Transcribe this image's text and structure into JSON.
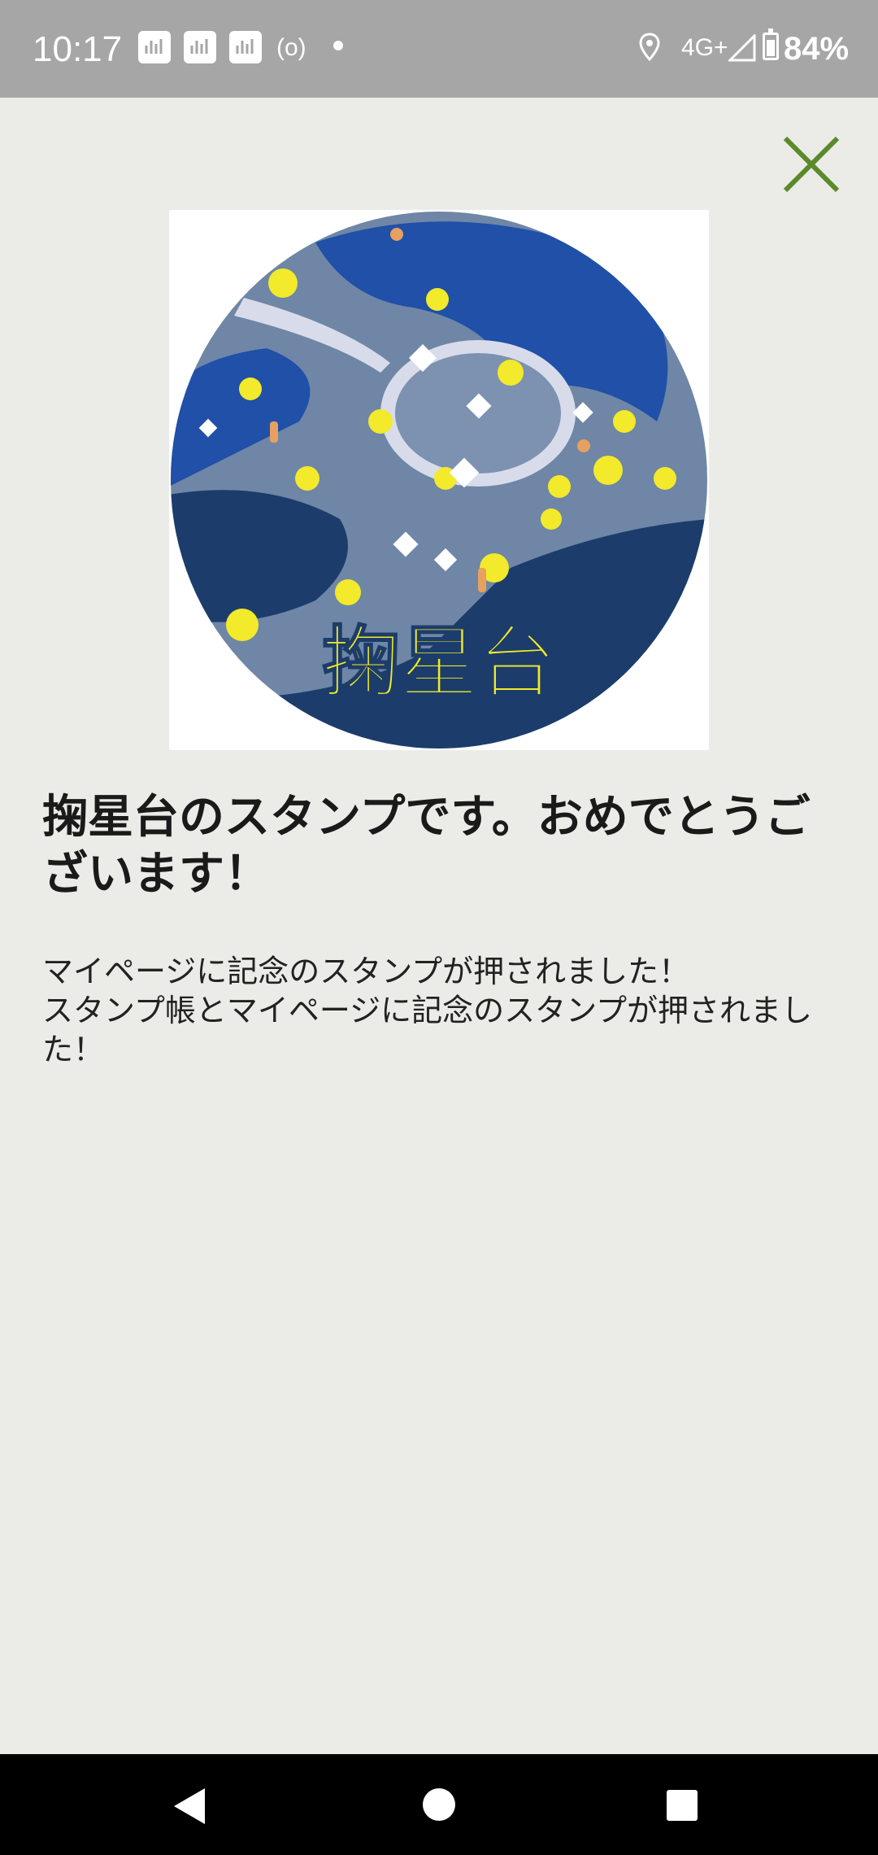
{
  "status_bar": {
    "time": "10:17",
    "network": "4G+",
    "battery": "84%",
    "radio_symbol": "(o)"
  },
  "close_icon": "close-icon",
  "stamp": {
    "logo_text": "掬星台",
    "colors": {
      "navy": "#1c3d6b",
      "blue": "#2050a8",
      "slate": "#6f86a6",
      "yellow": "#f2ea2a"
    }
  },
  "dialog": {
    "title": "掬星台のスタンプです。おめでとうございます！",
    "message_line_1": "マイページに記念のスタンプが押されました！",
    "message_line_2": "スタンプ帳とマイページに記念のスタンプが押されました！"
  },
  "accent_color": "#5a8a2a"
}
